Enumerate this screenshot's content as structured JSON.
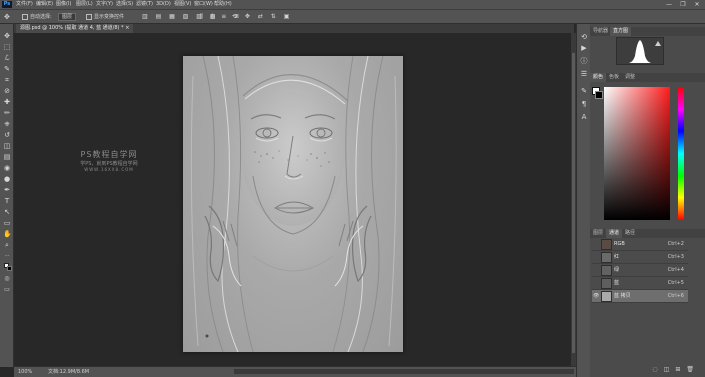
{
  "app": {
    "logo": "Ps"
  },
  "menubar": {
    "items": [
      "文件(F)",
      "编辑(E)",
      "图像(I)",
      "图层(L)",
      "文字(Y)",
      "选择(S)",
      "滤镜(T)",
      "3D(D)",
      "视图(V)",
      "窗口(W)",
      "帮助(H)"
    ],
    "window_controls": {
      "minimize": "—",
      "restore": "❐",
      "close": "✕"
    }
  },
  "options_bar": {
    "auto_select_label": "自动选择:",
    "auto_select_target": "图层",
    "show_transform_label": "显示变换控件"
  },
  "document": {
    "tab_label": "源图.psd @ 100% (提取 通道 4, 蓝 通道/8) *",
    "watermark": {
      "title": "PS教程自学网",
      "subtitle": "学PS，就到PS教程自学网",
      "url": "WWW.16XX8.COM"
    }
  },
  "status_bar": {
    "zoom": "100%",
    "doc_info": "文档:12.9M/8.6M"
  },
  "panels": {
    "top_tabs": [
      "导航器",
      "直方图"
    ],
    "top_active": 1,
    "color_tabs": [
      "颜色",
      "色板",
      "调整"
    ],
    "color_active": 0,
    "layer_tabs": [
      "图层",
      "通道",
      "路径"
    ],
    "layer_active": 1,
    "channels": [
      {
        "name": "RGB",
        "shortcut": "Ctrl+2",
        "visible": false,
        "selected": false
      },
      {
        "name": "红",
        "shortcut": "Ctrl+3",
        "visible": false,
        "selected": false
      },
      {
        "name": "绿",
        "shortcut": "Ctrl+4",
        "visible": false,
        "selected": false
      },
      {
        "name": "蓝",
        "shortcut": "Ctrl+5",
        "visible": false,
        "selected": false
      },
      {
        "name": "蓝 拷贝",
        "shortcut": "Ctrl+6",
        "visible": true,
        "selected": true
      }
    ]
  },
  "icons": {
    "tools": [
      "move-icon",
      "marquee-icon",
      "lasso-icon",
      "quick-select-icon",
      "crop-icon",
      "eyedropper-icon",
      "healing-icon",
      "brush-icon",
      "stamp-icon",
      "history-brush-icon",
      "eraser-icon",
      "gradient-icon",
      "blur-icon",
      "dodge-icon",
      "pen-icon",
      "type-icon",
      "path-select-icon",
      "shape-icon",
      "hand-icon",
      "zoom-icon"
    ],
    "tool_glyphs": [
      "✥",
      "⬚",
      "ℒ",
      "✎",
      "⌗",
      "⊘",
      "✚",
      "✏",
      "⎈",
      "↺",
      "◫",
      "▤",
      "◉",
      "●",
      "✒",
      "T",
      "↖",
      "▭",
      "✋",
      "⌕"
    ]
  },
  "colors": {
    "foreground": "#ffffff",
    "background": "#000000"
  }
}
